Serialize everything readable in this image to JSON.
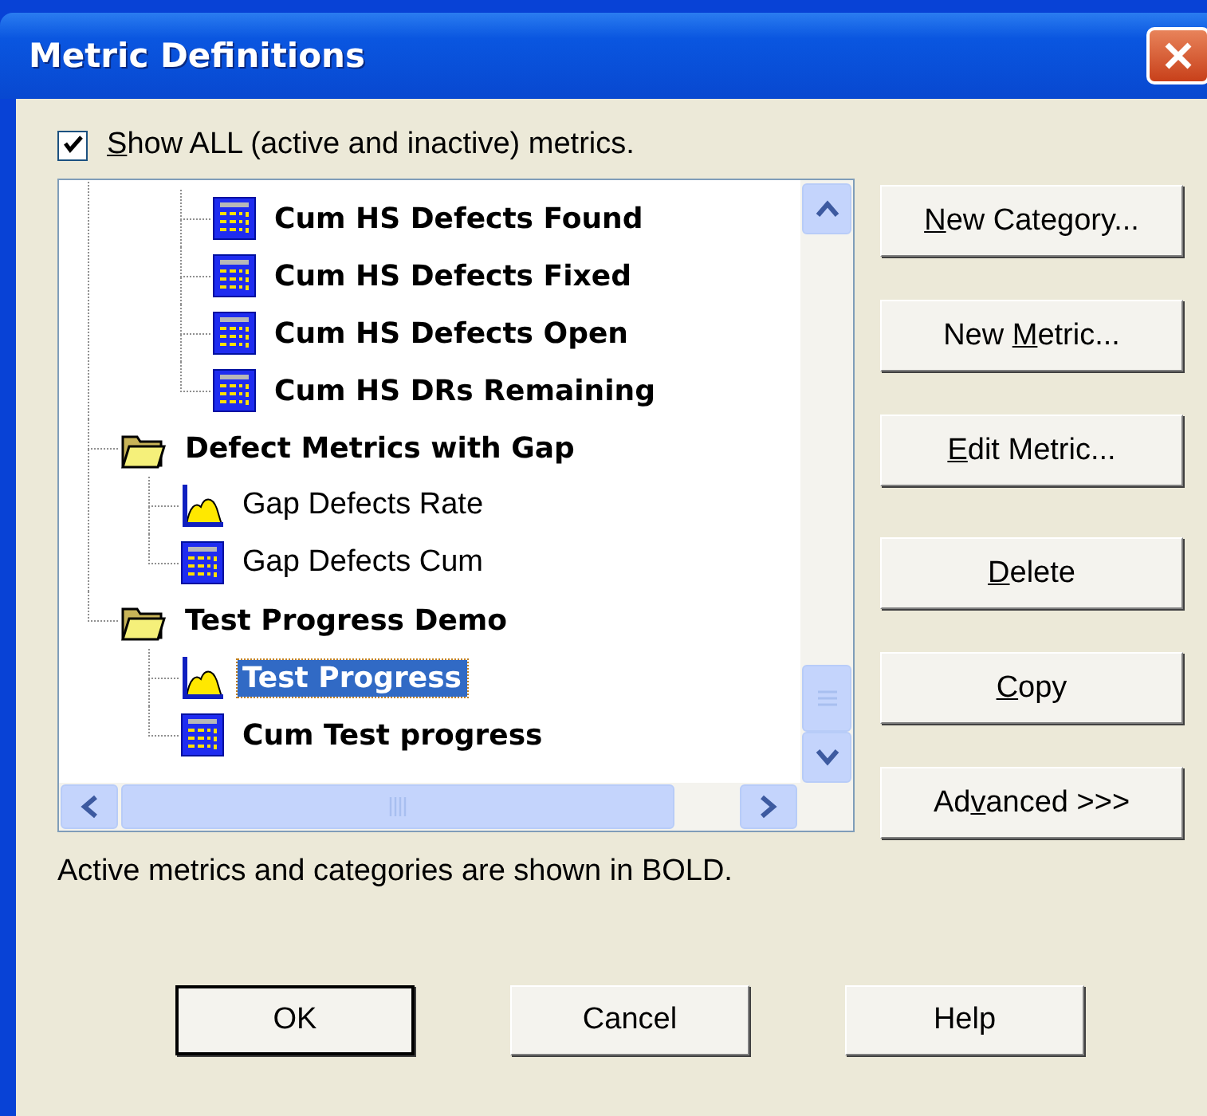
{
  "window": {
    "title": "Metric Definitions"
  },
  "show_all": {
    "label": {
      "key": "S",
      "post": "how ALL (active and inactive) metrics."
    },
    "checked": true
  },
  "tree": [
    {
      "children": [
        {
          "kind": "table",
          "label": "Cum HS Defects Found",
          "active": true,
          "selected": false
        },
        {
          "kind": "table",
          "label": "Cum HS Defects Fixed",
          "active": true,
          "selected": false
        },
        {
          "kind": "table",
          "label": "Cum HS Defects Open",
          "active": true,
          "selected": false
        },
        {
          "kind": "table",
          "label": "Cum HS DRs Remaining",
          "active": true,
          "selected": false
        }
      ]
    },
    {
      "label": "Defect Metrics with Gap",
      "active": true,
      "selected": false,
      "children": [
        {
          "kind": "chart",
          "label": "Gap Defects Rate",
          "active": false,
          "selected": false
        },
        {
          "kind": "table",
          "label": "Gap Defects Cum",
          "active": false,
          "selected": false
        }
      ]
    },
    {
      "label": "Test Progress Demo",
      "active": true,
      "selected": false,
      "children": [
        {
          "kind": "chart",
          "label": "Test Progress",
          "active": true,
          "selected": true
        },
        {
          "kind": "table",
          "label": "Cum Test progress",
          "active": true,
          "selected": false
        }
      ]
    }
  ],
  "side_buttons": [
    {
      "label": {
        "key": "N",
        "post": "ew Category..."
      }
    },
    {
      "label": {
        "pre": "New ",
        "key": "M",
        "post": "etric..."
      }
    },
    {
      "label": {
        "key": "E",
        "post": "dit Metric..."
      }
    },
    {
      "label": {
        "key": "D",
        "post": "elete"
      }
    },
    {
      "label": {
        "key": "C",
        "post": "opy"
      }
    },
    {
      "label": {
        "pre": "Ad",
        "key": "v",
        "post": "anced >>>"
      }
    }
  ],
  "note": "Active metrics and categories are shown in BOLD.",
  "buttons": [
    {
      "label": "OK",
      "default": true
    },
    {
      "label": "Cancel",
      "default": false
    },
    {
      "label": "Help",
      "default": false
    }
  ]
}
